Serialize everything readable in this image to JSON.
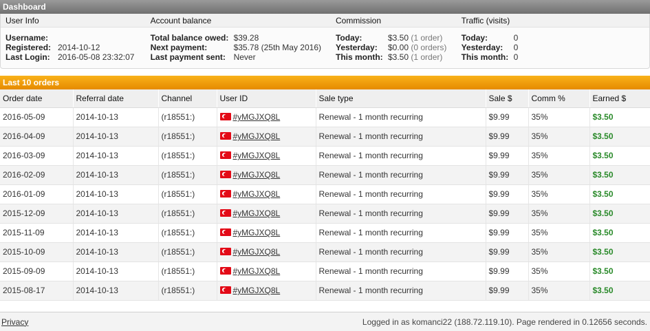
{
  "dashboard": {
    "title": "Dashboard",
    "sections": {
      "user_info": "User Info",
      "account_balance": "Account balance",
      "commission": "Commission",
      "traffic": "Traffic (visits)"
    },
    "user": {
      "username_label": "Username:",
      "username": "",
      "registered_label": "Registered:",
      "registered": "2014-10-12",
      "last_login_label": "Last Login:",
      "last_login": "2016-05-08 23:32:07"
    },
    "balance": {
      "total_label": "Total balance owed:",
      "total": "$39.28",
      "next_label": "Next payment:",
      "next": "$35.78",
      "next_note": "(25th May 2016)",
      "last_label": "Last payment sent:",
      "last": "Never"
    },
    "commission": {
      "today_label": "Today:",
      "today": "$3.50",
      "today_note": "(1 order)",
      "yesterday_label": "Yesterday:",
      "yesterday": "$0.00",
      "yesterday_note": "(0 orders)",
      "month_label": "This month:",
      "month": "$3.50",
      "month_note": "(1 order)"
    },
    "traffic": {
      "today_label": "Today:",
      "today": "0",
      "yesterday_label": "Yesterday:",
      "yesterday": "0",
      "month_label": "This month:",
      "month": "0"
    }
  },
  "orders": {
    "title": "Last 10 orders",
    "columns": [
      "Order date",
      "Referral date",
      "Channel",
      "User ID",
      "Sale type",
      "Sale $",
      "Comm %",
      "Earned $"
    ],
    "rows": [
      {
        "order_date": "2016-05-09",
        "referral_date": "2014-10-13",
        "channel": "(r18551:)",
        "user_id": "#yMGJXQ8L",
        "sale_type": "Renewal - 1 month recurring",
        "sale": "$9.99",
        "comm": "35%",
        "earned": "$3.50"
      },
      {
        "order_date": "2016-04-09",
        "referral_date": "2014-10-13",
        "channel": "(r18551:)",
        "user_id": "#yMGJXQ8L",
        "sale_type": "Renewal - 1 month recurring",
        "sale": "$9.99",
        "comm": "35%",
        "earned": "$3.50"
      },
      {
        "order_date": "2016-03-09",
        "referral_date": "2014-10-13",
        "channel": "(r18551:)",
        "user_id": "#yMGJXQ8L",
        "sale_type": "Renewal - 1 month recurring",
        "sale": "$9.99",
        "comm": "35%",
        "earned": "$3.50"
      },
      {
        "order_date": "2016-02-09",
        "referral_date": "2014-10-13",
        "channel": "(r18551:)",
        "user_id": "#yMGJXQ8L",
        "sale_type": "Renewal - 1 month recurring",
        "sale": "$9.99",
        "comm": "35%",
        "earned": "$3.50"
      },
      {
        "order_date": "2016-01-09",
        "referral_date": "2014-10-13",
        "channel": "(r18551:)",
        "user_id": "#yMGJXQ8L",
        "sale_type": "Renewal - 1 month recurring",
        "sale": "$9.99",
        "comm": "35%",
        "earned": "$3.50"
      },
      {
        "order_date": "2015-12-09",
        "referral_date": "2014-10-13",
        "channel": "(r18551:)",
        "user_id": "#yMGJXQ8L",
        "sale_type": "Renewal - 1 month recurring",
        "sale": "$9.99",
        "comm": "35%",
        "earned": "$3.50"
      },
      {
        "order_date": "2015-11-09",
        "referral_date": "2014-10-13",
        "channel": "(r18551:)",
        "user_id": "#yMGJXQ8L",
        "sale_type": "Renewal - 1 month recurring",
        "sale": "$9.99",
        "comm": "35%",
        "earned": "$3.50"
      },
      {
        "order_date": "2015-10-09",
        "referral_date": "2014-10-13",
        "channel": "(r18551:)",
        "user_id": "#yMGJXQ8L",
        "sale_type": "Renewal - 1 month recurring",
        "sale": "$9.99",
        "comm": "35%",
        "earned": "$3.50"
      },
      {
        "order_date": "2015-09-09",
        "referral_date": "2014-10-13",
        "channel": "(r18551:)",
        "user_id": "#yMGJXQ8L",
        "sale_type": "Renewal - 1 month recurring",
        "sale": "$9.99",
        "comm": "35%",
        "earned": "$3.50"
      },
      {
        "order_date": "2015-08-17",
        "referral_date": "2014-10-13",
        "channel": "(r18551:)",
        "user_id": "#yMGJXQ8L",
        "sale_type": "Renewal - 1 month recurring",
        "sale": "$9.99",
        "comm": "35%",
        "earned": "$3.50"
      }
    ],
    "flag_icon": "turkey-flag-icon"
  },
  "footer": {
    "privacy": "Privacy",
    "status": "Logged in as komanci22 (188.72.119.10). Page rendered in 0.12656 seconds."
  },
  "colors": {
    "header_gray": "#808080",
    "header_orange": "#f0a010",
    "earned_green": "#2a8a2a"
  }
}
